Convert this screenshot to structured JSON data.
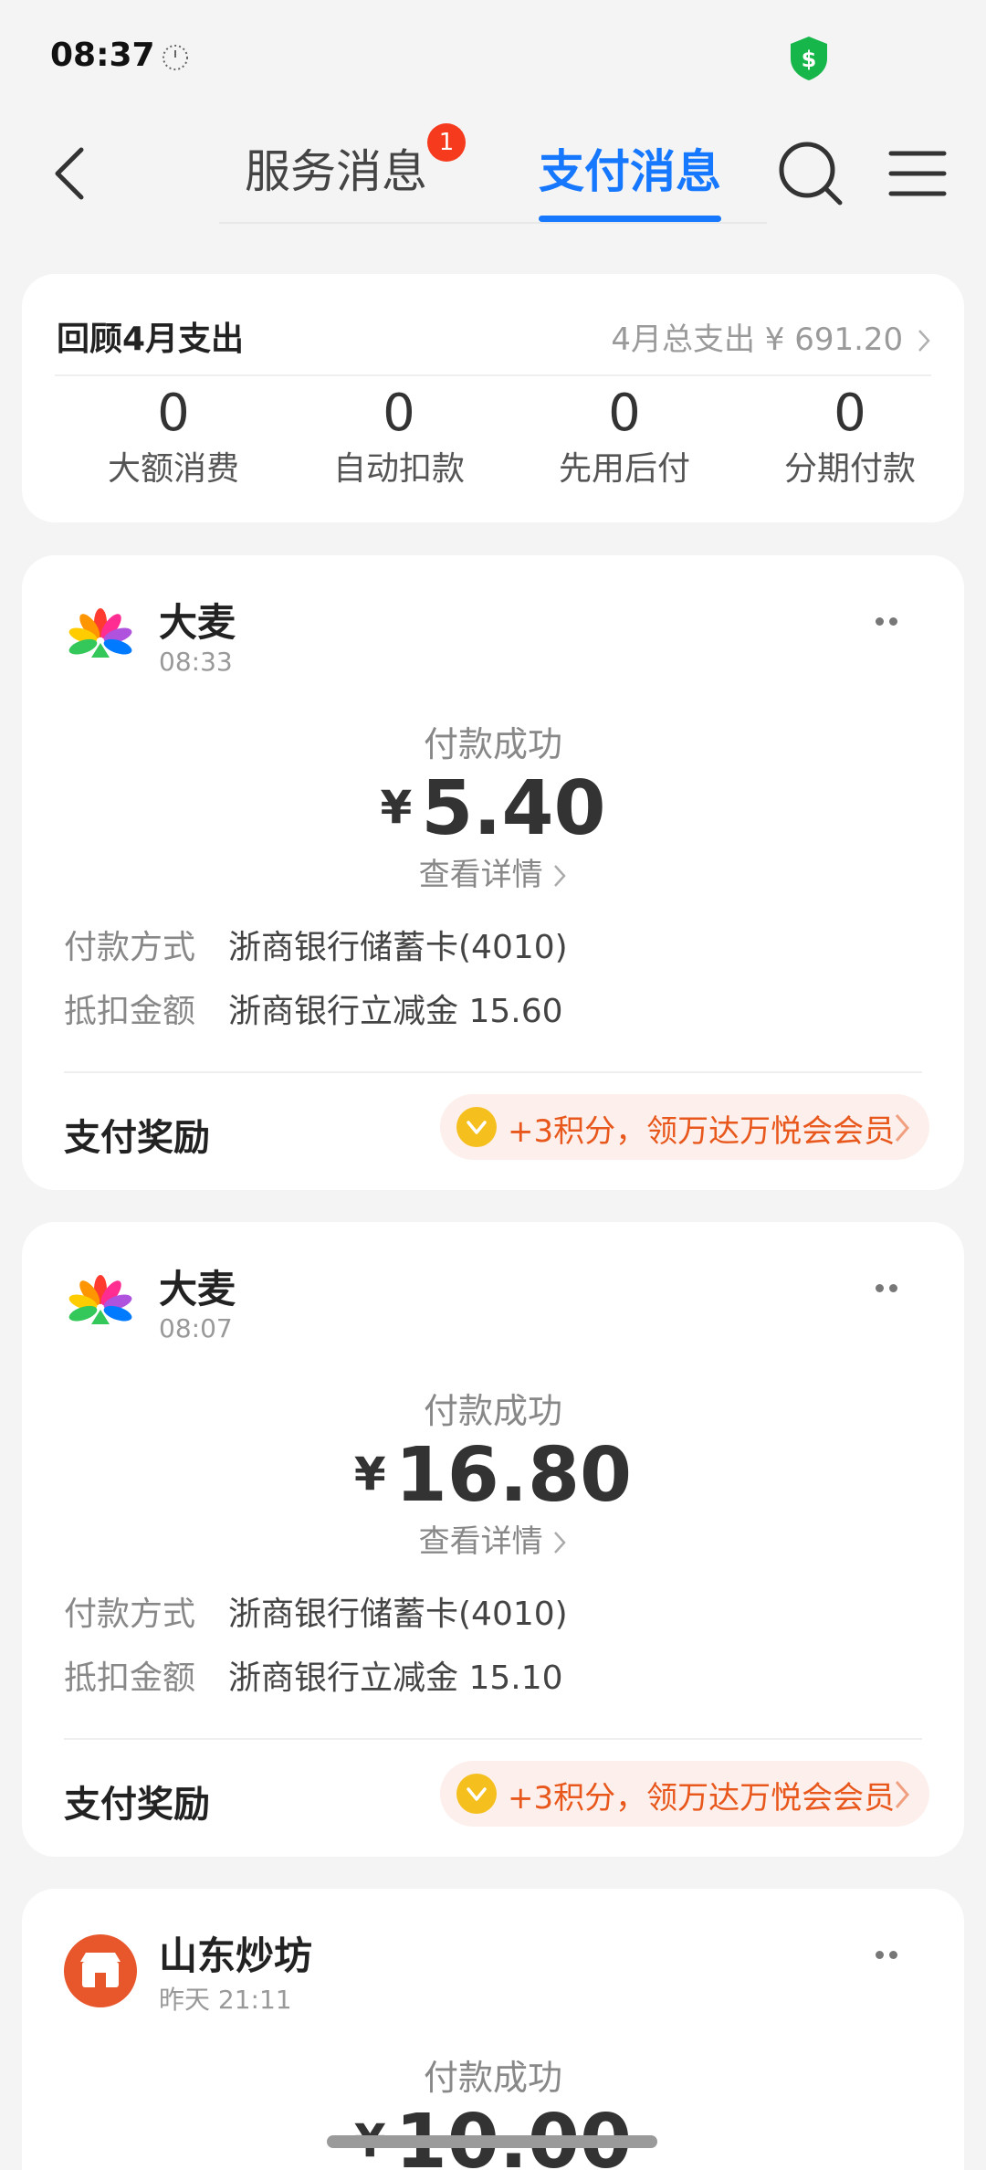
{
  "status_bar": {
    "time": "08:37"
  },
  "header": {
    "tab_service": "服务消息",
    "tab_service_badge": "1",
    "tab_pay": "支付消息"
  },
  "summary": {
    "title": "回顾4月支出",
    "total": "4月总支出 ¥ 691.20",
    "stats": [
      {
        "value": "0",
        "label": "大额消费"
      },
      {
        "value": "0",
        "label": "自动扣款"
      },
      {
        "value": "0",
        "label": "先用后付"
      },
      {
        "value": "0",
        "label": "分期付款"
      }
    ]
  },
  "transactions": [
    {
      "merchant": "大麦",
      "time": "08:33",
      "status": "付款成功",
      "currency": "¥",
      "amount": "5.40",
      "detail_link": "查看详情",
      "pay_method_label": "付款方式",
      "pay_method": "浙商银行储蓄卡(4010)",
      "deduct_label": "抵扣金额",
      "deduct": "浙商银行立减金 15.60",
      "reward_label": "支付奖励",
      "reward_text": "+3积分，领万达万悦会会员"
    },
    {
      "merchant": "大麦",
      "time": "08:07",
      "status": "付款成功",
      "currency": "¥",
      "amount": "16.80",
      "detail_link": "查看详情",
      "pay_method_label": "付款方式",
      "pay_method": "浙商银行储蓄卡(4010)",
      "deduct_label": "抵扣金额",
      "deduct": "浙商银行立减金 15.10",
      "reward_label": "支付奖励",
      "reward_text": "+3积分，领万达万悦会会员"
    },
    {
      "merchant": "山东炒坊",
      "time": "昨天 21:11",
      "status": "付款成功",
      "currency": "¥",
      "amount": "10.00"
    }
  ],
  "colors": {
    "accent": "#1677ff",
    "badge": "#f53a1e",
    "reward": "#e8571c",
    "shop_logo": "#e8562b"
  }
}
